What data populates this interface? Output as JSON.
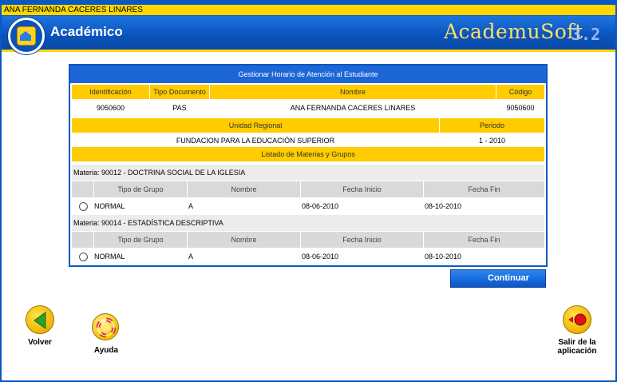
{
  "user_bar": {
    "name": "ANA FERNANDA CACERES LINARES"
  },
  "header": {
    "app_title": "Académico",
    "brand": "AcademuSoft",
    "brand_version": "3.2"
  },
  "panel": {
    "title": "Gestionar Horario de Atención al Estudiante",
    "student_headers": [
      "Identificación",
      "Tipo Documento",
      "Nombre",
      "Código"
    ],
    "student_values": [
      "9050600",
      "PAS",
      "ANA FERNANDA CACERES LINARES",
      "9050600"
    ],
    "unit_headers": [
      "Unidad Regional",
      "Periodo"
    ],
    "unit_values": [
      "FUNDACION PARA LA EDUCACIÓN SUPERIOR",
      "1 - 2010"
    ],
    "list_title": "Listado de Materias y Grupos",
    "group_headers": [
      "Tipo de Grupo",
      "Nombre",
      "Fecha Inicio",
      "Fecha Fin"
    ],
    "subjects": [
      {
        "label": "Materia: 90012 - DOCTRINA SOCIAL DE LA IGLESIA",
        "row": [
          "NORMAL",
          "A",
          "08-06-2010",
          "08-10-2010"
        ]
      },
      {
        "label": "Materia: 90014 - ESTADÍSTICA DESCRIPTIVA",
        "row": [
          "NORMAL",
          "A",
          "08-06-2010",
          "08-10-2010"
        ]
      }
    ]
  },
  "continue_label": "Continuar",
  "nav": {
    "back": "Volver",
    "help": "Ayuda",
    "exit_line1": "Salir de la",
    "exit_line2": "aplicación"
  },
  "icons": {
    "logo": "academusoft-logo-icon",
    "back": "arrow-left-icon",
    "help": "lifebuoy-icon",
    "exit": "exit-door-icon",
    "continue": "arrow-right-icon"
  },
  "colors": {
    "brand_blue": "#0a58c4",
    "accent_yellow": "#ffcc00"
  }
}
